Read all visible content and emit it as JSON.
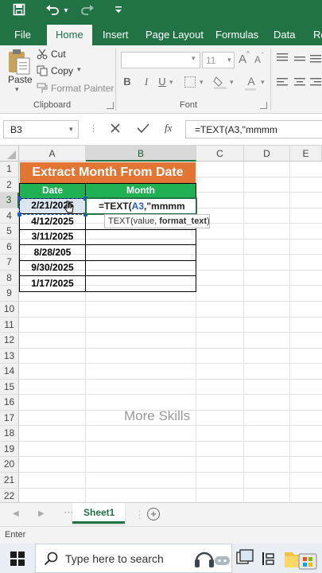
{
  "quick_access": {
    "save_icon": "save-icon",
    "undo_icon": "undo-icon",
    "redo_icon": "redo-icon",
    "customize_icon": "customize-icon"
  },
  "ribbon_tabs": [
    "File",
    "Home",
    "Insert",
    "Page Layout",
    "Formulas",
    "Data",
    "Re"
  ],
  "clipboard": {
    "paste": "Paste",
    "cut": "Cut",
    "copy": "Copy",
    "format_painter": "Format Painter",
    "label": "Clipboard"
  },
  "font_group": {
    "font_size": "11",
    "label": "Font",
    "bold": "B",
    "italic": "I",
    "underline": "U",
    "grow": "A",
    "shrink": "A"
  },
  "formula_bar": {
    "name_box": "B3",
    "fx": "fx",
    "formula": "=TEXT(A3,\"mmmm"
  },
  "columns": [
    "A",
    "B",
    "C",
    "D",
    "E"
  ],
  "rows": [
    "1",
    "2",
    "3",
    "4",
    "5",
    "6",
    "7",
    "8",
    "9",
    "10",
    "11",
    "12",
    "13",
    "14",
    "15",
    "16",
    "17",
    "18",
    "19",
    "20",
    "21",
    "22"
  ],
  "table": {
    "title": "Extract Month From Date",
    "headers": [
      "Date",
      "Month"
    ],
    "dates": [
      "2/21/2025",
      "4/12/2025",
      "3/11/2025",
      "8/28/205",
      "9/30/2025",
      "1/17/2025"
    ],
    "active_formula_prefix": "=TEXT(",
    "active_formula_ref": "A3",
    "active_formula_suffix": ",\"mmmm"
  },
  "tooltip": {
    "func": "TEXT(value, ",
    "arg": "format_text",
    "close": ")"
  },
  "watermark": "More Skills",
  "sheet_tab": "Sheet1",
  "status": "Enter",
  "taskbar": {
    "search_placeholder": "Type here to search"
  },
  "colors": {
    "excel_green": "#217346",
    "title_orange": "#e27533",
    "header_green": "#1fb154",
    "ref_blue": "#1f5fbf"
  }
}
